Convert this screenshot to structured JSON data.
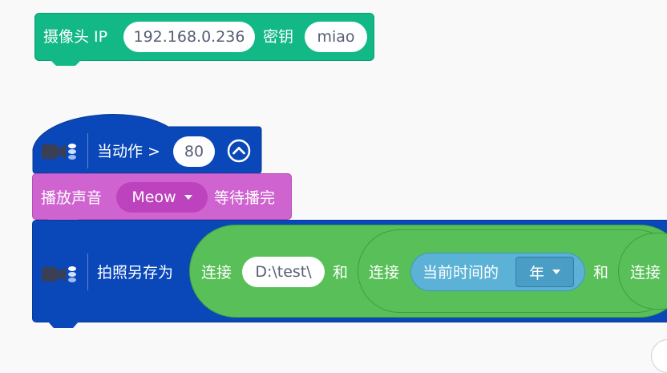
{
  "camera_block": {
    "label": "摄像头 IP",
    "ip_value": "192.168.0.236",
    "key_label": "密钥",
    "key_value": "miao"
  },
  "action_block": {
    "label": "当动作 >",
    "value": "80"
  },
  "sound_block": {
    "label": "播放声音",
    "sound": "Meow",
    "suffix": "等待播完"
  },
  "photo_block": {
    "label": "拍照另存为",
    "join1_label": "连接",
    "path_value": "D:\\test\\",
    "and1_label": "和",
    "join2_label": "连接",
    "time_label": "当前时间的",
    "time_unit": "年",
    "and2_label": "和",
    "join3_label": "连接"
  },
  "colors": {
    "camera_green": "#12b886",
    "event_blue": "#0a47b8",
    "sound_purple": "#cf63cf",
    "operator_green": "#59c059",
    "sensing_blue": "#5cb1d6"
  }
}
